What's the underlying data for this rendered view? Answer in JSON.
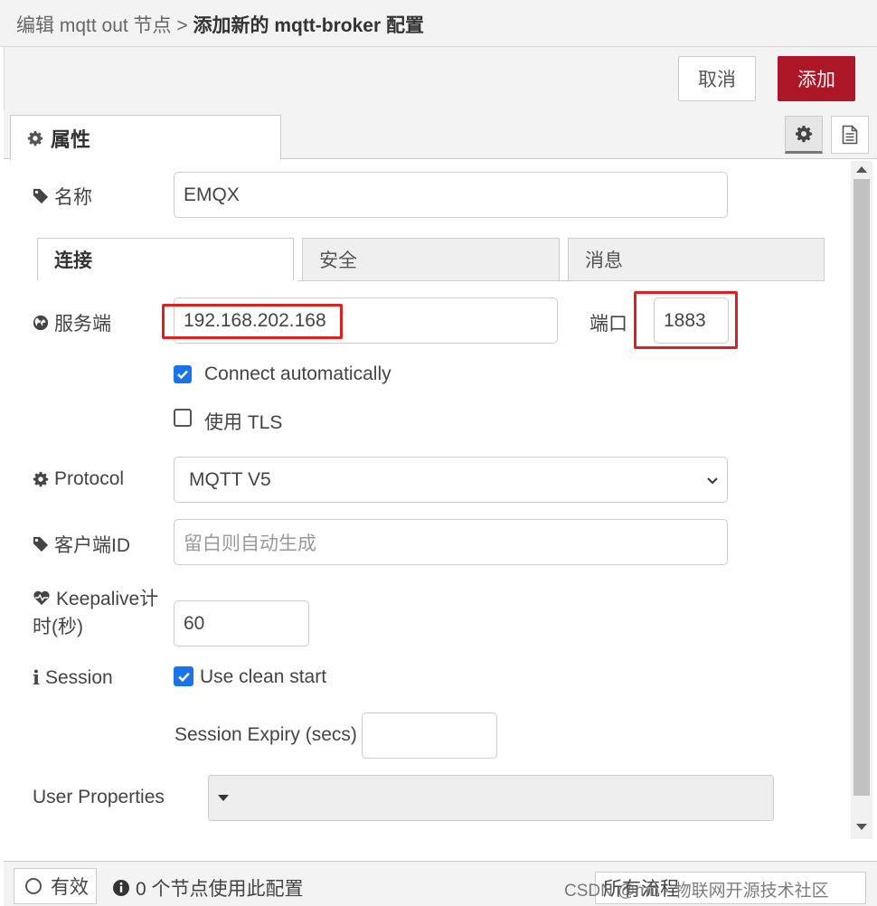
{
  "header": {
    "breadcrumb_prefix": "编辑 mqtt out 节点 > ",
    "title": "添加新的 mqtt-broker 配置"
  },
  "toolbar": {
    "cancel_label": "取消",
    "add_label": "添加"
  },
  "tabs": {
    "properties_label": "属性"
  },
  "form": {
    "name_label": "名称",
    "name_value": "EMQX",
    "subtabs": [
      "连接",
      "安全",
      "消息"
    ],
    "server_label": "服务端",
    "server_value": "192.168.202.168",
    "port_label": "端口",
    "port_value": "1883",
    "auto_connect_label": "Connect automatically",
    "auto_connect_checked": true,
    "use_tls_label": "使用 TLS",
    "use_tls_checked": false,
    "protocol_label": "Protocol",
    "protocol_value": "MQTT V5",
    "client_id_label": "客户端ID",
    "client_id_placeholder": "留白则自动生成",
    "keepalive_label_line1": "Keepalive计",
    "keepalive_label_line2": "时(秒)",
    "keepalive_value": "60",
    "session_label": "Session",
    "clean_start_label": "Use clean start",
    "clean_start_checked": true,
    "session_expiry_label": "Session Expiry (secs)",
    "session_expiry_value": "",
    "user_properties_label": "User Properties"
  },
  "footer": {
    "valid_label": "有效",
    "usage_text": "0 个节点使用此配置",
    "flows_label": "所有流程",
    "watermark": "CSDN @mb - 物联网开源技术社区"
  },
  "colors": {
    "primary": "#ad1625",
    "highlight": "#e02020",
    "checkbox": "#1a73e8"
  }
}
